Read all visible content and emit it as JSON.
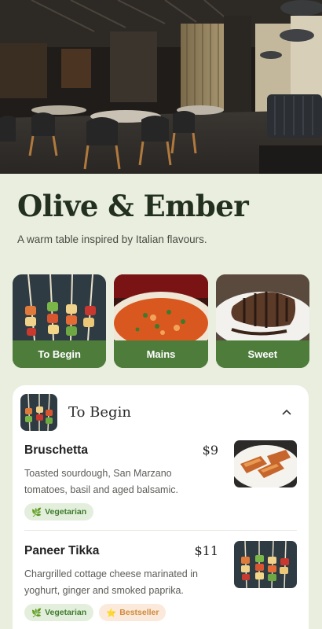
{
  "hero": {
    "image": "restaurant-interior-photo"
  },
  "brand": {
    "name": "Olive & Ember",
    "tagline": "A warm table inspired by Italian flavours."
  },
  "categories": [
    {
      "label": "To Begin",
      "image": "skewers-photo"
    },
    {
      "label": "Mains",
      "image": "curry-photo"
    },
    {
      "label": "Sweet",
      "image": "dessert-photo"
    }
  ],
  "section": {
    "title": "To Begin",
    "expanded": true,
    "chevron": "chevron-up-icon"
  },
  "items": [
    {
      "name": "Bruschetta",
      "price": "$9",
      "desc_line1": "Toasted sourdough, San Marzano",
      "desc_line2": "tomatoes, basil and aged balsamic.",
      "tags": [
        "Vegetarian"
      ]
    },
    {
      "name": "Paneer Tikka",
      "price": "$11",
      "desc_line1": "Chargrilled cottage cheese marinated in",
      "desc_line2": "yoghurt, ginger and smoked paprika.",
      "tags": [
        "Vegetarian",
        "Bestseller"
      ]
    }
  ],
  "colors": {
    "background": "#e9eedf",
    "accent_green": "#4e7c3b",
    "tag_veg_bg": "#e3efdc",
    "tag_best_bg": "#fbeadb"
  }
}
